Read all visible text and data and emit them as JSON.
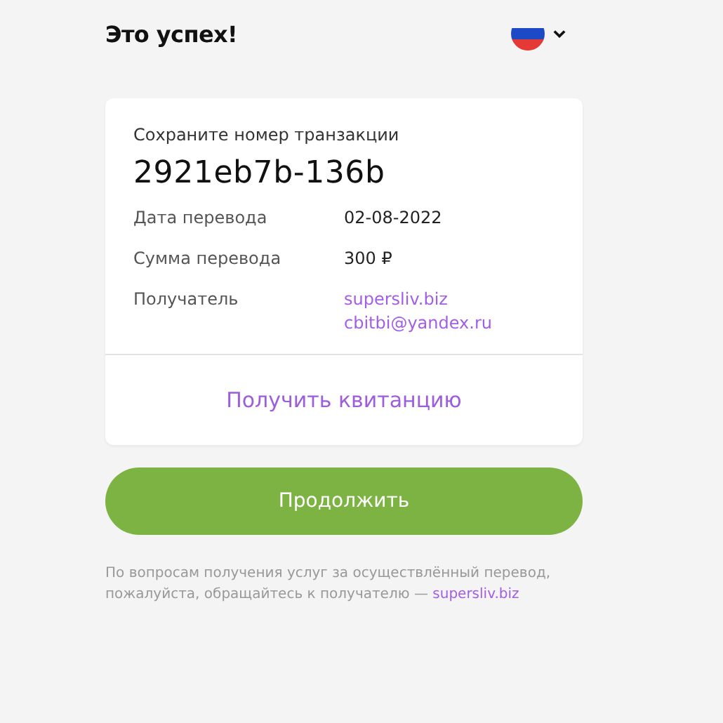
{
  "header": {
    "title": "Это успех!"
  },
  "transaction": {
    "caption": "Сохраните номер транзакции",
    "number": "2921eb7b-136b"
  },
  "details": [
    {
      "label": "Дата перевода",
      "values": [
        {
          "text": "02-08-2022",
          "kind": "text"
        }
      ]
    },
    {
      "label": "Сумма перевода",
      "values": [
        {
          "text": "300 ₽",
          "kind": "text"
        }
      ]
    },
    {
      "label": "Получатель",
      "values": [
        {
          "text": "supersliv.biz",
          "kind": "link"
        },
        {
          "text": "cbitbi@yandex.ru",
          "kind": "link"
        }
      ]
    }
  ],
  "receipt_link": "Получить квитанцию",
  "continue_button": "Продолжить",
  "footer": {
    "text": "По вопросам получения услуг за осуществлённый перевод, пожалуйста, обращайтесь к получателю —",
    "link": "supersliv.biz"
  }
}
